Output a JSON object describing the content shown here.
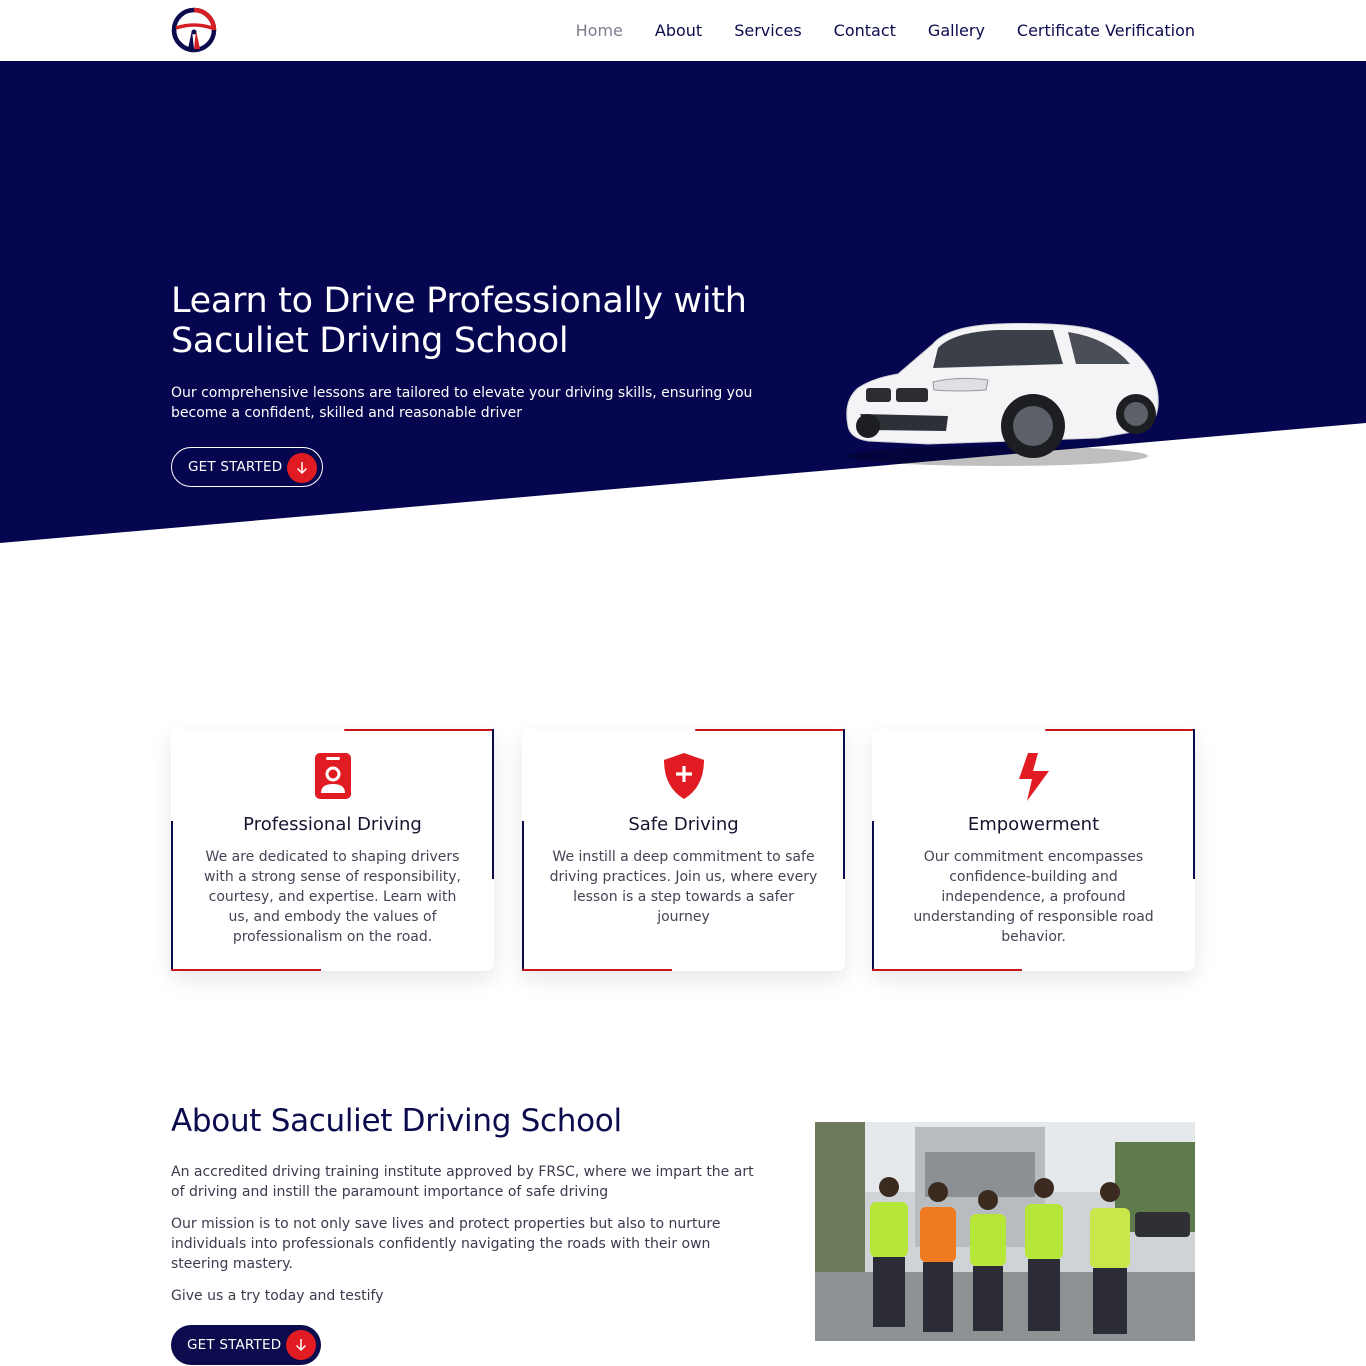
{
  "header": {
    "nav": [
      {
        "label": "Home",
        "active": true
      },
      {
        "label": "About",
        "active": false
      },
      {
        "label": "Services",
        "active": false
      },
      {
        "label": "Contact",
        "active": false
      },
      {
        "label": "Gallery",
        "active": false
      },
      {
        "label": "Certificate Verification",
        "active": false
      }
    ]
  },
  "hero": {
    "title": "Learn to Drive Professionally with Saculiet Driving School",
    "subtitle": "Our comprehensive lessons are tailored to elevate your driving skills, ensuring you become a confident, skilled and reasonable driver",
    "cta_label": "GET STARTED",
    "cta_icon": "arrow-down-icon"
  },
  "features": [
    {
      "title": "Professional Driving",
      "icon": "id-badge-icon",
      "text": "We are dedicated to shaping drivers with a strong sense of responsibility, courtesy, and expertise. Learn with us, and embody the values of professionalism on the road."
    },
    {
      "title": "Safe Driving",
      "icon": "shield-plus-icon",
      "text": "We instill a deep commitment to safe driving practices. Join us, where every lesson is a step towards a safer journey"
    },
    {
      "title": "Empowerment",
      "icon": "lightning-icon",
      "text": "Our commitment encompasses confidence-building and independence, a profound understanding of responsible road behavior."
    }
  ],
  "about": {
    "title": "About Saculiet Driving School",
    "paragraphs": [
      "An accredited driving training institute approved by FRSC, where we impart the art of driving and instill the paramount importance of safe driving",
      "Our mission is to not only save lives and protect properties but also to nurture individuals into professionals confidently navigating the roads with their own steering mastery.",
      "Give us a try today and testify"
    ],
    "cta_label": "GET STARTED"
  },
  "colors": {
    "navy": "#0b0b4e",
    "red": "#e11b22",
    "white": "#ffffff"
  }
}
